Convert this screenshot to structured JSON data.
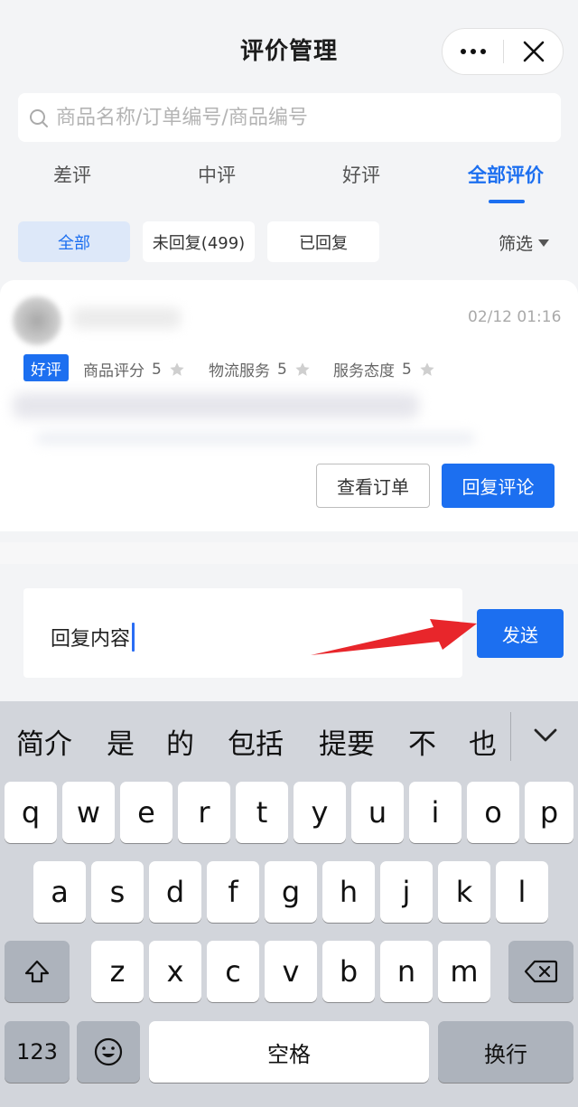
{
  "header": {
    "title": "评价管理",
    "more_icon": "more-dots-icon",
    "close_icon": "close-icon"
  },
  "search": {
    "placeholder": "商品名称/订单编号/商品编号",
    "icon": "search-icon"
  },
  "tabs": [
    {
      "label": "差评",
      "active": false
    },
    {
      "label": "中评",
      "active": false
    },
    {
      "label": "好评",
      "active": false
    },
    {
      "label": "全部评价",
      "active": true
    }
  ],
  "filters": {
    "chips": [
      {
        "label": "全部",
        "active": true
      },
      {
        "label": "未回复(499)",
        "active": false
      },
      {
        "label": "已回复",
        "active": false
      }
    ],
    "screen_label": "筛选"
  },
  "review": {
    "time": "02/12 01:16",
    "badge": "好评",
    "ratings": [
      {
        "label": "商品评分",
        "score": "5"
      },
      {
        "label": "物流服务",
        "score": "5"
      },
      {
        "label": "服务态度",
        "score": "5"
      }
    ],
    "view_order_label": "查看订单",
    "reply_label": "回复评论"
  },
  "reply": {
    "value": "回复内容",
    "send_label": "发送"
  },
  "keyboard": {
    "candidates": [
      "简介",
      "是",
      "的",
      "包括",
      "提要",
      "不",
      "也"
    ],
    "row1": [
      "q",
      "w",
      "e",
      "r",
      "t",
      "y",
      "u",
      "i",
      "o",
      "p"
    ],
    "row2": [
      "a",
      "s",
      "d",
      "f",
      "g",
      "h",
      "j",
      "k",
      "l"
    ],
    "row3": [
      "z",
      "x",
      "c",
      "v",
      "b",
      "n",
      "m"
    ],
    "numbers_label": "123",
    "space_label": "空格",
    "return_label": "换行"
  },
  "colors": {
    "accent": "#1c6ff0",
    "arrow": "#e8262b",
    "background": "#f3f4f6",
    "keyboard": "#d2d5db"
  }
}
